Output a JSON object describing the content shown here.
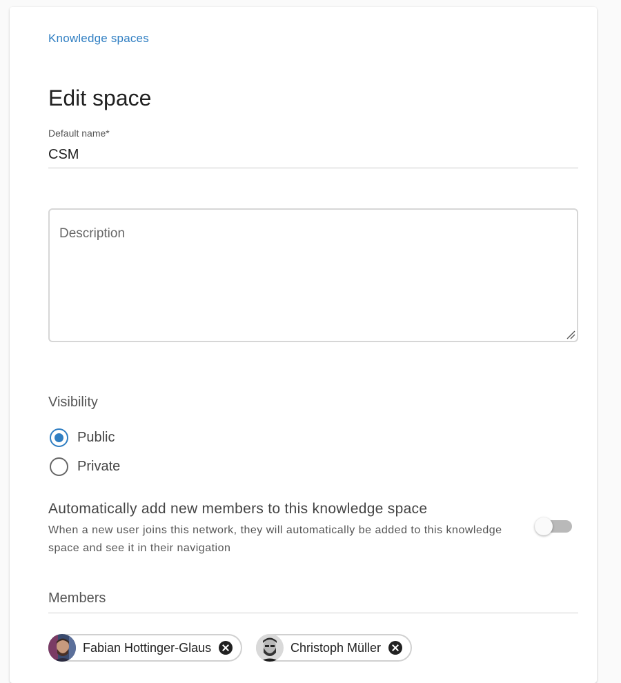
{
  "breadcrumb": {
    "label": "Knowledge spaces"
  },
  "page": {
    "title": "Edit space"
  },
  "form": {
    "name_label": "Default name*",
    "name_value": "CSM",
    "description_placeholder": "Description",
    "visibility": {
      "label": "Visibility",
      "options": [
        {
          "label": "Public",
          "selected": true
        },
        {
          "label": "Private",
          "selected": false
        }
      ]
    },
    "auto_add": {
      "title": "Automatically add new members to this knowledge space",
      "description": "When a new user joins this network, they will automatically be added to this knowledge space and see it in their navigation",
      "enabled": false
    },
    "members": {
      "label": "Members",
      "list": [
        {
          "name": "Fabian Hottinger-Glaus"
        },
        {
          "name": "Christoph Müller"
        }
      ]
    }
  },
  "colors": {
    "accent": "#2f7ec2",
    "text": "#212121",
    "muted": "#555555"
  }
}
